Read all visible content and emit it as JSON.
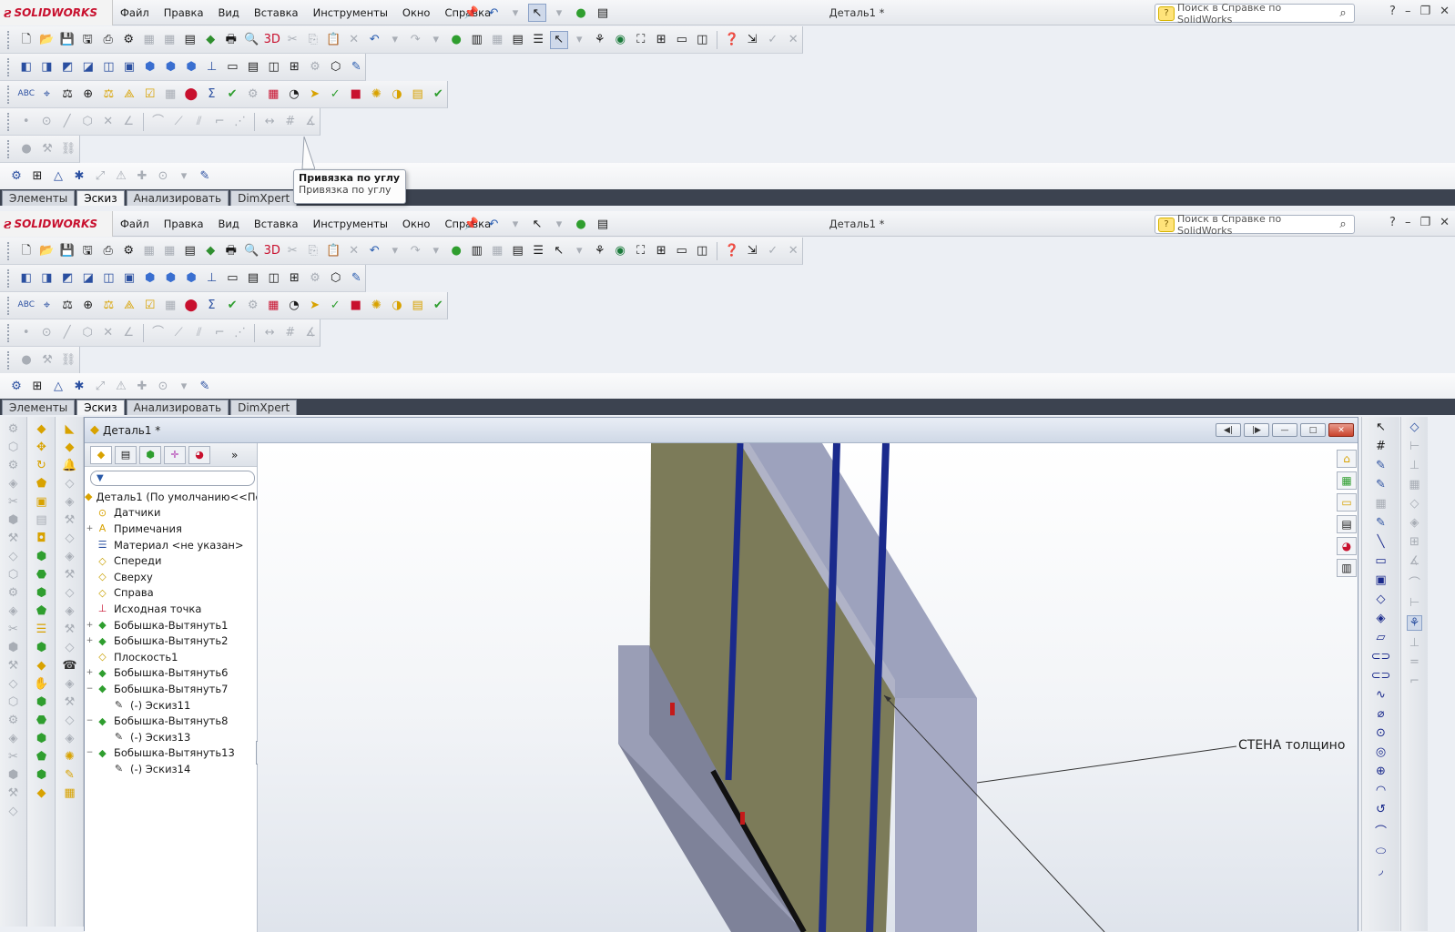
{
  "app": {
    "logo_ds": "ƨ",
    "logo_text": "SOLIDWORKS",
    "doc_title": "Деталь1 *",
    "brand_red": "#c8102e"
  },
  "menu": [
    "Файл",
    "Правка",
    "Вид",
    "Вставка",
    "Инструменты",
    "Окно",
    "Справка"
  ],
  "search": {
    "value": "Поиск в Справке по SolidWorks",
    "help": "?"
  },
  "tabs": [
    "Элементы",
    "Эскиз",
    "Анализировать",
    "DimXpert"
  ],
  "active_tab": "Эскиз",
  "tooltip": {
    "title": "Привязка по углу",
    "text": "Привязка по углу"
  },
  "toolbar_icons": {
    "standard": [
      "new-icon",
      "open-icon",
      "save-icon",
      "print-icon",
      "undo-icon",
      "redo-icon",
      "rebuild-icon",
      "options-icon",
      "select-icon",
      "help-icon"
    ],
    "view": [
      "front-view-icon",
      "back-view-icon",
      "left-view-icon",
      "right-view-icon",
      "top-view-icon",
      "bottom-view-icon",
      "iso-view-icon"
    ],
    "sketch": [
      "point-icon",
      "circle-icon",
      "line-icon",
      "polygon-icon",
      "trim-icon",
      "angle-icon"
    ]
  },
  "document": {
    "title": "Деталь1 *"
  },
  "tree": {
    "root": "Деталь1  (По умолчанию<<По",
    "items": [
      {
        "label": "Датчики",
        "icon": "sensor-icon",
        "expand": ""
      },
      {
        "label": "Примечания",
        "icon": "annotations-icon",
        "expand": "+"
      },
      {
        "label": "Материал <не указан>",
        "icon": "material-icon",
        "expand": ""
      },
      {
        "label": "Спереди",
        "icon": "plane-icon",
        "expand": ""
      },
      {
        "label": "Сверху",
        "icon": "plane-icon",
        "expand": ""
      },
      {
        "label": "Справа",
        "icon": "plane-icon",
        "expand": ""
      },
      {
        "label": "Исходная точка",
        "icon": "origin-icon",
        "expand": ""
      },
      {
        "label": "Бобышка-Вытянуть1",
        "icon": "boss-extrude-icon",
        "expand": "+"
      },
      {
        "label": "Бобышка-Вытянуть2",
        "icon": "boss-extrude-icon",
        "expand": "+"
      },
      {
        "label": "Плоскость1",
        "icon": "plane-icon",
        "expand": ""
      },
      {
        "label": "Бобышка-Вытянуть6",
        "icon": "boss-extrude-icon",
        "expand": "+"
      },
      {
        "label": "Бобышка-Вытянуть7",
        "icon": "boss-extrude-icon",
        "expand": "−"
      },
      {
        "label": "(-) Эскиз11",
        "icon": "sketch-icon",
        "expand": "",
        "indent": true
      },
      {
        "label": "Бобышка-Вытянуть8",
        "icon": "boss-extrude-icon",
        "expand": "−"
      },
      {
        "label": "(-) Эскиз13",
        "icon": "sketch-icon",
        "expand": "",
        "indent": true
      },
      {
        "label": "Бобышка-Вытянуть13",
        "icon": "boss-extrude-icon",
        "expand": "−"
      },
      {
        "label": "(-) Эскиз14",
        "icon": "sketch-icon",
        "expand": "",
        "indent": true
      }
    ]
  },
  "annotation": {
    "text": "СТЕНА толщино"
  },
  "colors": {
    "wall_face": "#7c7b59",
    "wall_side": "#a7acc4",
    "rebar": "#1a2a8c",
    "tabbar": "#3c4350"
  }
}
